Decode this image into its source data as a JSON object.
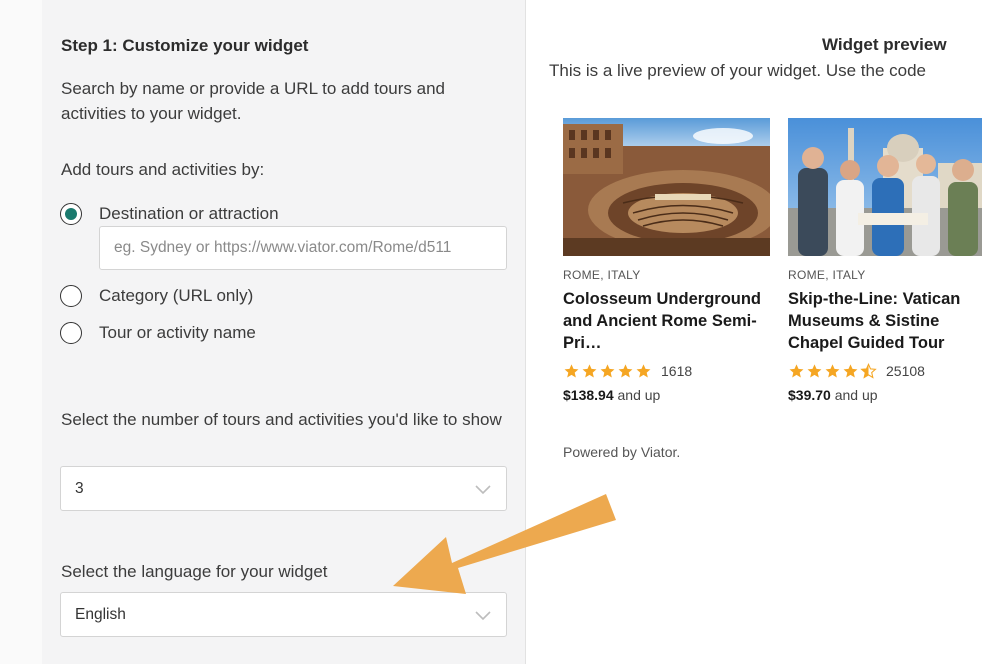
{
  "step": {
    "title": "Step 1: Customize your widget",
    "description": "Search by name or provide a URL to add tours and activities to your widget.",
    "add_by_label": "Add tours and activities by:",
    "options": [
      {
        "label": "Destination or attraction",
        "selected": true
      },
      {
        "label": "Category (URL only)",
        "selected": false
      },
      {
        "label": "Tour or activity name",
        "selected": false
      }
    ],
    "search_placeholder": "eg. Sydney or https://www.viator.com/Rome/d511",
    "count_label": "Select the number of tours and activities you'd like to show",
    "count_value": "3",
    "language_label": "Select the language for your widget",
    "language_value": "English"
  },
  "preview": {
    "title": "Widget preview",
    "subtitle": "This is a live preview of your widget. Use the code",
    "powered_by": "Powered by Viator.",
    "cards": [
      {
        "location": "ROME, ITALY",
        "title": "Colosseum Underground and Ancient Rome Semi-Pri…",
        "rating": 5,
        "reviews": "1618",
        "price": "$138.94",
        "price_suffix": "and up"
      },
      {
        "location": "ROME, ITALY",
        "title": "Skip-the-Line: Vatican Museums & Sistine Chapel Guided Tour",
        "rating": 4.5,
        "reviews": "25108",
        "price": "$39.70",
        "price_suffix": "and up"
      }
    ]
  },
  "colors": {
    "accent": "#1a7a6e",
    "star": "#f5a623",
    "arrow": "#eda94f"
  }
}
